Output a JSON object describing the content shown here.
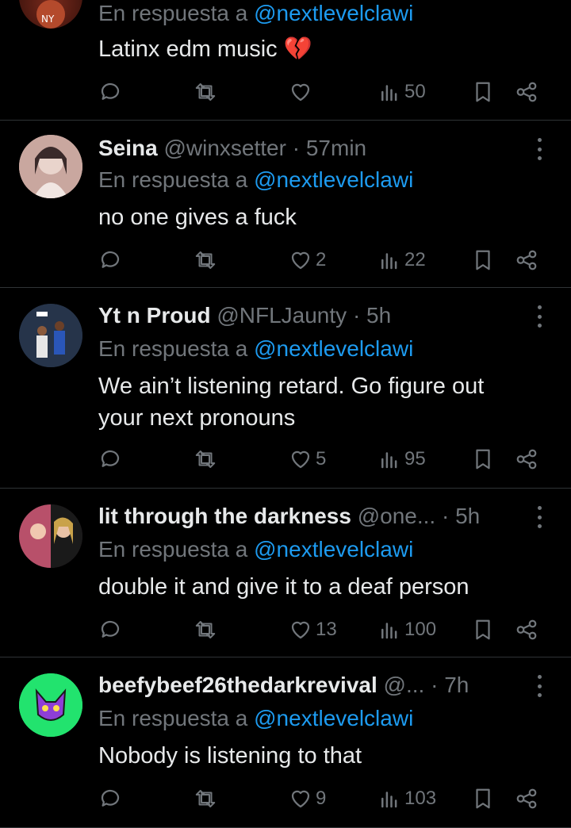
{
  "reply_prefix": "En respuesta a",
  "tweets": [
    {
      "name": "",
      "handle": "",
      "time": "",
      "mention": "@nextlevelclawi",
      "text": "Latinx edm music 💔",
      "stats": {
        "replies": "",
        "retweets": "",
        "likes": "",
        "views": "50"
      }
    },
    {
      "name": "Seina",
      "handle": "@winxsetter",
      "time": "57min",
      "mention": "@nextlevelclawi",
      "text": "no one gives a fuck",
      "stats": {
        "replies": "",
        "retweets": "",
        "likes": "2",
        "views": "22"
      }
    },
    {
      "name": "Yt n Proud",
      "handle": "@NFLJaunty",
      "time": "5h",
      "mention": "@nextlevelclawi",
      "text": "We ain’t listening retard. Go figure out your next pronouns",
      "stats": {
        "replies": "",
        "retweets": "",
        "likes": "5",
        "views": "95"
      }
    },
    {
      "name": "lit through the darkness",
      "handle": "@one...",
      "time": "5h",
      "mention": "@nextlevelclawi",
      "text": "double it and give it to a deaf person",
      "stats": {
        "replies": "",
        "retweets": "",
        "likes": "13",
        "views": "100"
      }
    },
    {
      "name": "beefybeef26thedarkrevival",
      "handle": "@...",
      "time": "7h",
      "mention": "@nextlevelclawi",
      "text": "Nobody is listening to that",
      "stats": {
        "replies": "",
        "retweets": "",
        "likes": "9",
        "views": "103"
      }
    }
  ],
  "icons": {
    "reply": "reply-icon",
    "retweet": "retweet-icon",
    "like": "heart-icon",
    "views": "views-icon",
    "bookmark": "bookmark-icon",
    "share": "share-icon",
    "more": "more-icon"
  },
  "colors": {
    "background": "#000000",
    "text": "#e7e9ea",
    "muted": "#71767b",
    "link": "#1d9bf0",
    "divider": "#2f3336"
  }
}
